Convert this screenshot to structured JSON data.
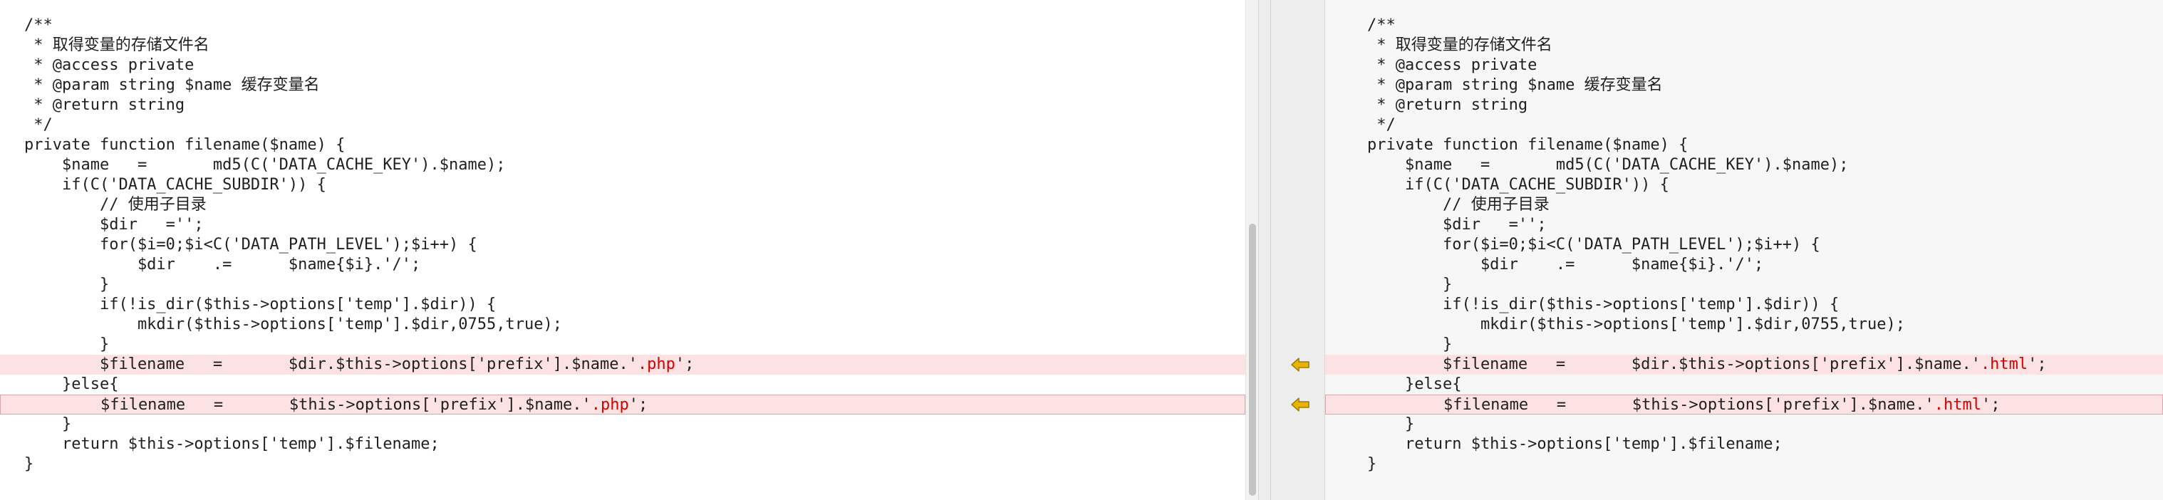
{
  "left_pane": {
    "lines": [
      {
        "segments": [
          {
            "text": "/**"
          }
        ]
      },
      {
        "segments": [
          {
            "text": " * 取得变量的存储文件名"
          }
        ]
      },
      {
        "segments": [
          {
            "text": " * @access private"
          }
        ]
      },
      {
        "segments": [
          {
            "text": " * @param string $name 缓存变量名"
          }
        ]
      },
      {
        "segments": [
          {
            "text": " * @return string"
          }
        ]
      },
      {
        "segments": [
          {
            "text": " */"
          }
        ]
      },
      {
        "segments": [
          {
            "text": "private function filename($name) {"
          }
        ]
      },
      {
        "segments": [
          {
            "text": "    $name   =       md5(C('DATA_CACHE_KEY').$name);"
          }
        ]
      },
      {
        "segments": [
          {
            "text": "    if(C('DATA_CACHE_SUBDIR')) {"
          }
        ]
      },
      {
        "segments": [
          {
            "text": "        // 使用子目录"
          }
        ]
      },
      {
        "segments": [
          {
            "text": "        $dir   ='';"
          }
        ]
      },
      {
        "segments": [
          {
            "text": "        for($i=0;$i<C('DATA_PATH_LEVEL');$i++) {"
          }
        ]
      },
      {
        "segments": [
          {
            "text": "            $dir    .=      $name{$i}.'/';"
          }
        ]
      },
      {
        "segments": [
          {
            "text": "        }"
          }
        ]
      },
      {
        "segments": [
          {
            "text": "        if(!is_dir($this->options['temp'].$dir)) {"
          }
        ]
      },
      {
        "segments": [
          {
            "text": "            mkdir($this->options['temp'].$dir,0755,true);"
          }
        ]
      },
      {
        "segments": [
          {
            "text": "        }"
          }
        ]
      },
      {
        "changed": true,
        "segments": [
          {
            "text": "        $filename   =       $dir.$this->options['prefix'].$name.'"
          },
          {
            "text": ".php",
            "hl": true
          },
          {
            "text": "';"
          }
        ]
      },
      {
        "segments": [
          {
            "text": "    }else{"
          }
        ]
      },
      {
        "changed": true,
        "selected": true,
        "segments": [
          {
            "text": "        $filename   =       $this->options['prefix'].$name.'"
          },
          {
            "text": ".php",
            "hl": true
          },
          {
            "text": "';"
          }
        ]
      },
      {
        "segments": [
          {
            "text": "    }"
          }
        ]
      },
      {
        "segments": [
          {
            "text": "    return $this->options['temp'].$filename;"
          }
        ]
      },
      {
        "segments": [
          {
            "text": "}"
          }
        ]
      },
      {
        "segments": [
          {
            "text": ""
          }
        ]
      }
    ]
  },
  "right_pane": {
    "lines": [
      {
        "segments": [
          {
            "text": "/**"
          }
        ]
      },
      {
        "segments": [
          {
            "text": " * 取得变量的存储文件名"
          }
        ]
      },
      {
        "segments": [
          {
            "text": " * @access private"
          }
        ]
      },
      {
        "segments": [
          {
            "text": " * @param string $name 缓存变量名"
          }
        ]
      },
      {
        "segments": [
          {
            "text": " * @return string"
          }
        ]
      },
      {
        "segments": [
          {
            "text": " */"
          }
        ]
      },
      {
        "segments": [
          {
            "text": "private function filename($name) {"
          }
        ]
      },
      {
        "segments": [
          {
            "text": "    $name   =       md5(C('DATA_CACHE_KEY').$name);"
          }
        ]
      },
      {
        "segments": [
          {
            "text": "    if(C('DATA_CACHE_SUBDIR')) {"
          }
        ]
      },
      {
        "segments": [
          {
            "text": "        // 使用子目录"
          }
        ]
      },
      {
        "segments": [
          {
            "text": "        $dir   ='';"
          }
        ]
      },
      {
        "segments": [
          {
            "text": "        for($i=0;$i<C('DATA_PATH_LEVEL');$i++) {"
          }
        ]
      },
      {
        "segments": [
          {
            "text": "            $dir    .=      $name{$i}.'/';"
          }
        ]
      },
      {
        "segments": [
          {
            "text": "        }"
          }
        ]
      },
      {
        "segments": [
          {
            "text": "        if(!is_dir($this->options['temp'].$dir)) {"
          }
        ]
      },
      {
        "segments": [
          {
            "text": "            mkdir($this->options['temp'].$dir,0755,true);"
          }
        ]
      },
      {
        "segments": [
          {
            "text": "        }"
          }
        ]
      },
      {
        "changed": true,
        "segments": [
          {
            "text": "        $filename   =       $dir.$this->options['prefix'].$name.'"
          },
          {
            "text": ".html",
            "hl": true
          },
          {
            "text": "';"
          }
        ]
      },
      {
        "segments": [
          {
            "text": "    }else{"
          }
        ]
      },
      {
        "changed": true,
        "selected": true,
        "segments": [
          {
            "text": "        $filename   =       $this->options['prefix'].$name.'"
          },
          {
            "text": ".html",
            "hl": true
          },
          {
            "text": "';"
          }
        ]
      },
      {
        "segments": [
          {
            "text": "    }"
          }
        ]
      },
      {
        "segments": [
          {
            "text": "    return $this->options['temp'].$filename;"
          }
        ]
      },
      {
        "segments": [
          {
            "text": "}"
          }
        ]
      },
      {
        "segments": [
          {
            "text": ""
          }
        ]
      }
    ]
  },
  "gutter": {
    "merge_arrows": [
      {
        "name": "merge-left-arrow-icon",
        "line_index": 17
      },
      {
        "name": "merge-left-arrow-icon",
        "line_index": 19
      }
    ]
  },
  "colors": {
    "changed_line_bg": "#fde2e4",
    "diff_highlight_text": "#d40000",
    "arrow_fill": "#e8b400",
    "arrow_stroke": "#9a7a00"
  }
}
